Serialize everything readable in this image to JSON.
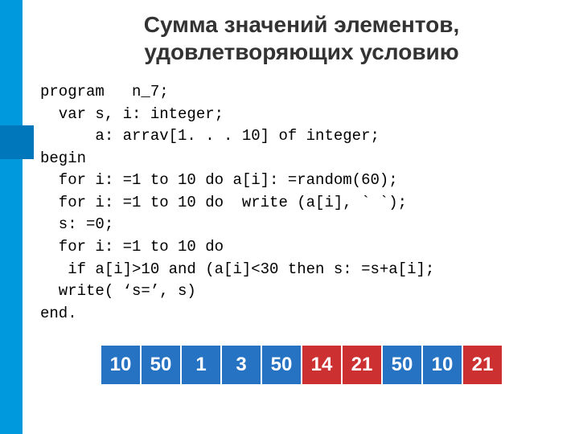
{
  "title_line1": "Сумма значений элементов,",
  "title_line2": "удовлетворяющих условию",
  "code": {
    "l1": "program   n_7;",
    "l2": "  var s, i: integer;",
    "l3": "      a: arrav[1. . . 10] of integer;",
    "l4": "begin",
    "l5": "  for i: =1 to 10 do a[i]: =random(60);",
    "l6": "  for i: =1 to 10 do  write (a[i], ` `);",
    "l7": "  s: =0;",
    "l8": "  for i: =1 to 10 do",
    "l9": "   if a[i]>10 and (a[i]<30 then s: =s+a[i];",
    "l10": "  write( ‘s=’, s)",
    "l11": "end."
  },
  "array_values": [
    "10",
    "50",
    "1",
    "3",
    "50",
    "14",
    "21",
    "50",
    "10",
    "21"
  ],
  "highlight_condition": "value > 10 and value < 30",
  "colors": {
    "cell_default": "#2673c4",
    "cell_highlight": "#cc3030",
    "stripe": "#0099dd"
  }
}
